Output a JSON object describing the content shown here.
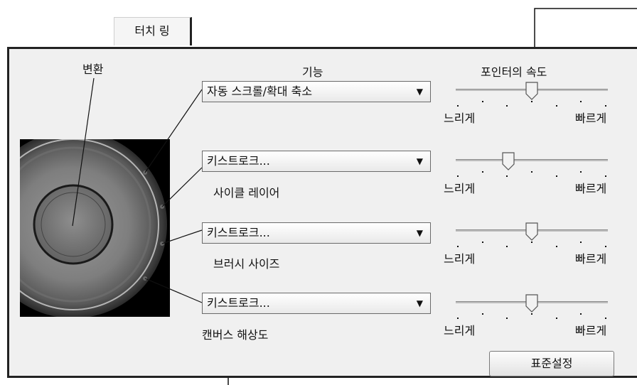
{
  "tab": {
    "label": "터치 링"
  },
  "headers": {
    "convert": "변환",
    "function": "기능",
    "pointer_speed": "포인터의 속도"
  },
  "rows": [
    {
      "dropdown": "자동 스크롤/확대 축소",
      "sublabel": "",
      "speed": 0.5
    },
    {
      "dropdown": "키스트로크...",
      "sublabel": "사이클 레이어",
      "speed": 0.33
    },
    {
      "dropdown": "키스트로크...",
      "sublabel": "브러시 사이즈",
      "speed": 0.5
    },
    {
      "dropdown": "키스트로크...",
      "sublabel": "캔버스 해상도",
      "speed": 0.5
    }
  ],
  "slider_labels": {
    "slow": "느리게",
    "fast": "빠르게"
  },
  "default_button": "표준설정",
  "icons": {
    "dropdown_arrow": "dropdown-arrow-icon"
  }
}
